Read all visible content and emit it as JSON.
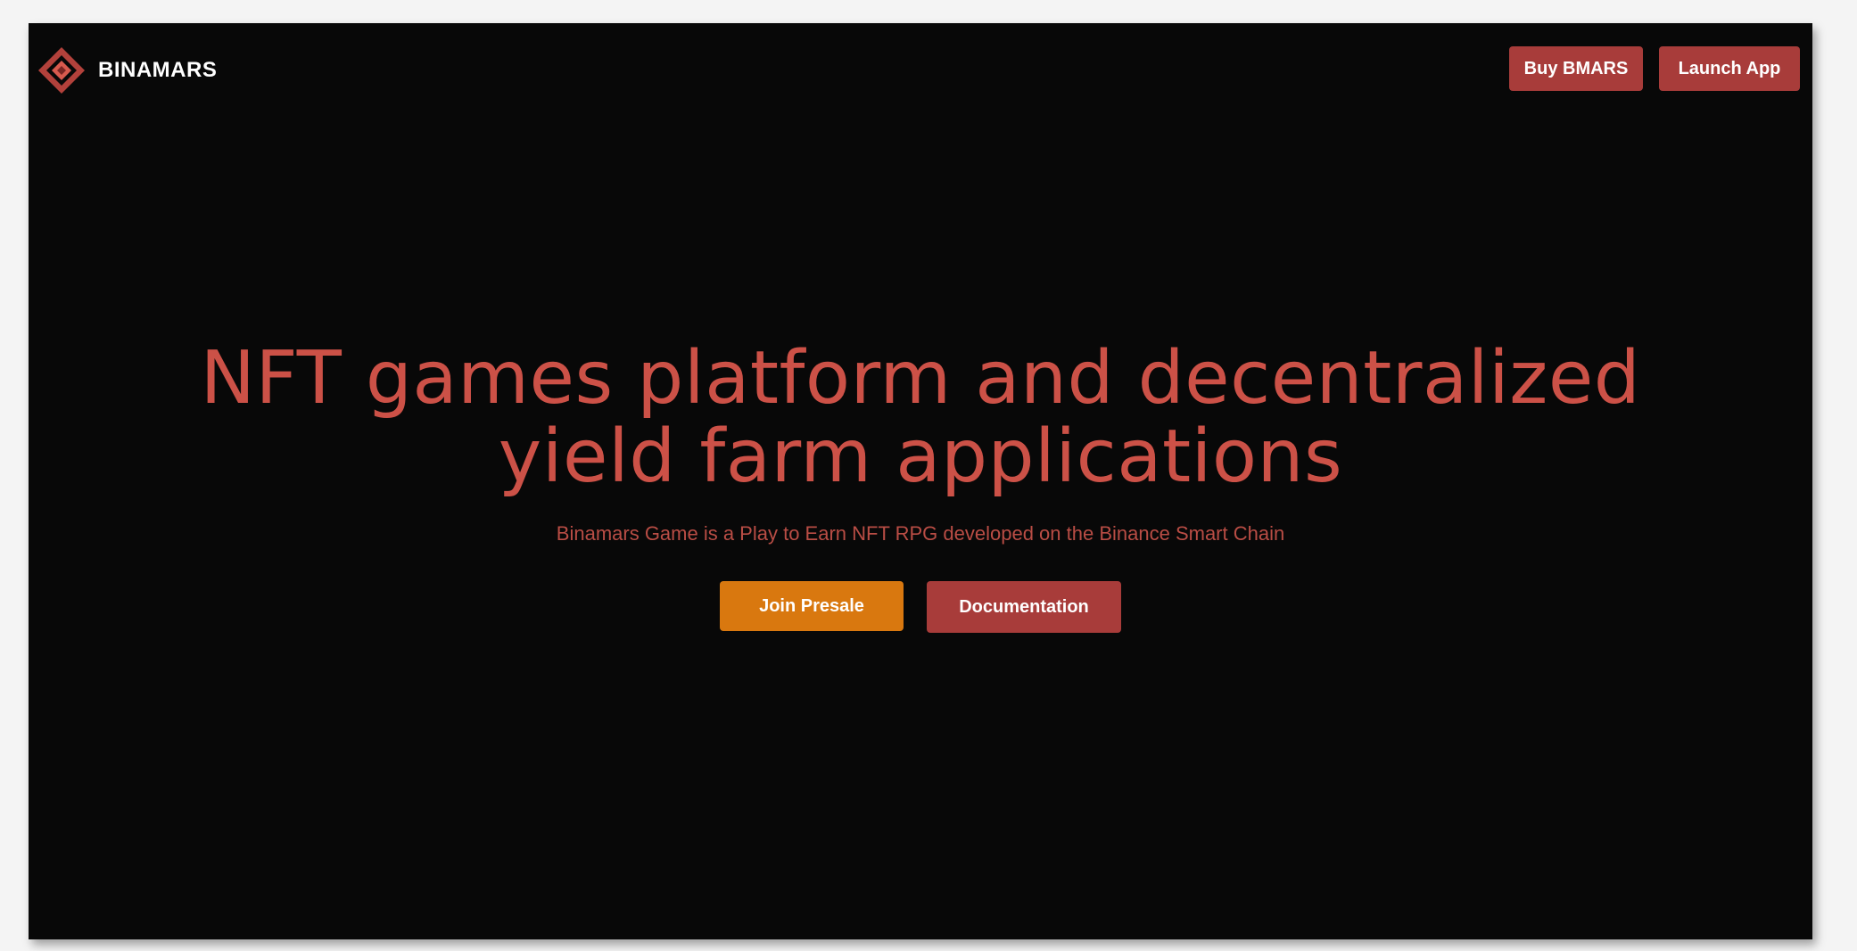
{
  "header": {
    "brand_name": "BINAMARS",
    "logo_icon": "binamars-diamond-logo-icon",
    "buy_label": "Buy BMARS",
    "launch_label": "Launch App"
  },
  "hero": {
    "headline_line1": "NFT games platform and decentralized",
    "headline_line2": "yield farm applications",
    "subtitle": "Binamars Game is a Play to Earn NFT RPG developed on the Binance Smart Chain",
    "join_presale_label": "Join Presale",
    "documentation_label": "Documentation"
  },
  "colors": {
    "background": "#080808",
    "accent_red": "#a83c3a",
    "accent_orange": "#d9780f",
    "headline": "#cc5147"
  }
}
